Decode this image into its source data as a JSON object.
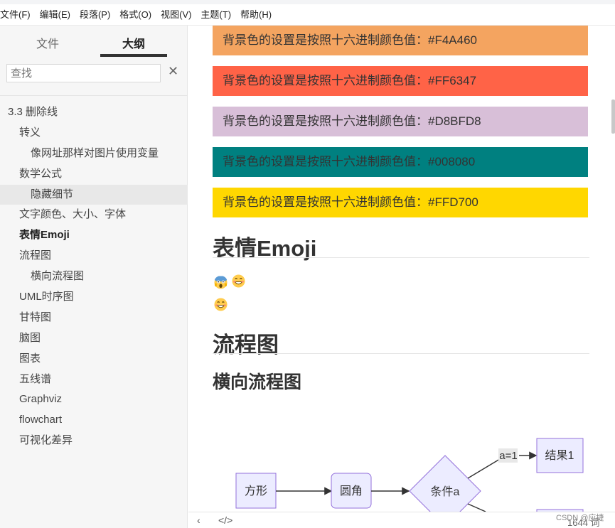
{
  "menu": {
    "items": [
      "文件(F)",
      "编辑(E)",
      "段落(P)",
      "格式(O)",
      "视图(V)",
      "主题(T)",
      "帮助(H)"
    ]
  },
  "sidebar": {
    "tabs": {
      "files": "文件",
      "outline": "大纲"
    },
    "search": {
      "placeholder": "查找"
    },
    "close_icon": "close-icon",
    "outline": [
      {
        "label": "3.3 删除线",
        "level": 1
      },
      {
        "label": "转义",
        "level": 2
      },
      {
        "label": "像网址那样对图片使用变量",
        "level": 3
      },
      {
        "label": "数学公式",
        "level": 2
      },
      {
        "label": "隐藏细节",
        "level": 3,
        "active": true
      },
      {
        "label": "文字颜色、大小、字体",
        "level": 2
      },
      {
        "label": "表情Emoji",
        "level": 2,
        "bold": true
      },
      {
        "label": "流程图",
        "level": 2
      },
      {
        "label": "横向流程图",
        "level": 3
      },
      {
        "label": "UML时序图",
        "level": 2
      },
      {
        "label": "甘特图",
        "level": 2
      },
      {
        "label": "脑图",
        "level": 2
      },
      {
        "label": "图表",
        "level": 2
      },
      {
        "label": "五线谱",
        "level": 2
      },
      {
        "label": "Graphviz",
        "level": 2
      },
      {
        "label": "flowchart",
        "level": 2
      },
      {
        "label": "可视化差异",
        "level": 2
      }
    ]
  },
  "content": {
    "color_boxes": [
      {
        "text": "背景色的设置是按照十六进制颜色值：#F4A460",
        "color": "#F4A460"
      },
      {
        "text": "背景色的设置是按照十六进制颜色值：#FF6347",
        "color": "#FF6347"
      },
      {
        "text": "背景色的设置是按照十六进制颜色值：#D8BFD8",
        "color": "#D8BFD8"
      },
      {
        "text": "背景色的设置是按照十六进制颜色值：#008080",
        "color": "#008080"
      },
      {
        "text": "背景色的设置是按照十六进制颜色值：#FFD700",
        "color": "#FFD700"
      }
    ],
    "heading_emoji": "表情Emoji",
    "emojis": [
      "scream-emoji",
      "grin-emoji",
      "grin-emoji"
    ],
    "heading_flow": "流程图",
    "heading_hflow": "横向流程图",
    "flowchart": {
      "nodes": {
        "square": "方形",
        "rounded": "圆角",
        "condition": "条件a",
        "result1": "结果1"
      },
      "edge_label": "a=1"
    }
  },
  "statusbar": {
    "back_icon": "‹",
    "code_icon": "</>",
    "word_count": "1644 词"
  },
  "watermark": "CSDN @应捷"
}
